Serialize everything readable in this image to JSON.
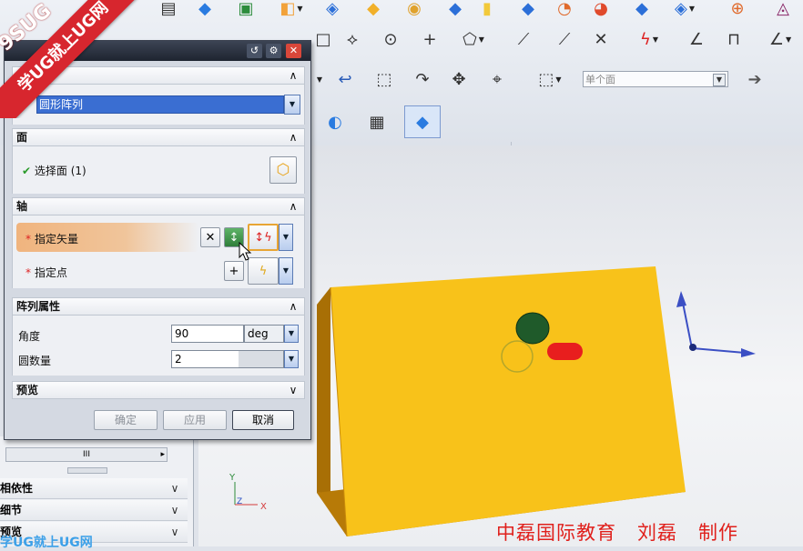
{
  "dialog": {
    "title_buttons": [
      "↺",
      "⚙",
      "✕"
    ],
    "type_value": "圆形阵列",
    "face_section": "面",
    "face_select_label": "选择面",
    "face_count": "(1)",
    "axis_section": "轴",
    "specify_vector": "指定矢量",
    "specify_point": "指定点",
    "array_props_section": "阵列属性",
    "angle_label": "角度",
    "angle_value": "90",
    "angle_unit": "deg",
    "count_label": "圆数量",
    "count_value": "2",
    "preview_section": "预览",
    "ok_button": "确定",
    "apply_button": "应用",
    "cancel_button": "取消"
  },
  "toolbar": {
    "face_filter_placeholder": "单个面"
  },
  "left_panel": {
    "scroll_thumb": "III",
    "rows": [
      "相依性",
      "细节",
      "预览"
    ]
  },
  "watermark": {
    "ribbon_text": "学UG就上UG网",
    "corner_text": "9SUG",
    "bottom_text": "学UG就上UG网"
  },
  "viewport": {
    "axis_x": "X",
    "axis_y": "Y",
    "axis_z": "Z"
  },
  "credit": "中磊国际教育   刘磊   制作",
  "colors": {
    "block_top": "#f8c21a",
    "block_side": "#b77a07",
    "hole_dark": "#1f5a2a",
    "slot_red": "#e81e1e",
    "accent": "#d7262e"
  }
}
